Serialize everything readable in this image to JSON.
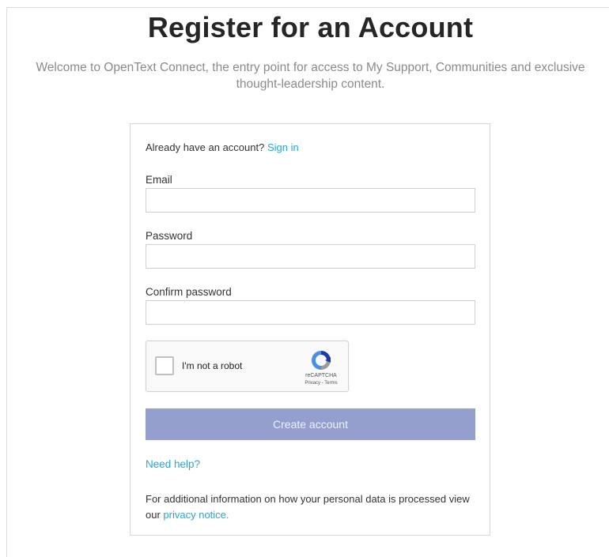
{
  "page": {
    "title": "Register for an Account",
    "intro_line1": "Welcome to OpenText Connect, the entry point for access to My Support, Communities and exclusive",
    "intro_line2": "thought-leadership content."
  },
  "form": {
    "signin_prompt": "Already have an account?",
    "signin_link": "Sign in",
    "email_label": "Email",
    "email_value": "",
    "password_label": "Password",
    "password_value": "",
    "confirm_label": "Confirm password",
    "confirm_value": "",
    "recaptcha": {
      "label": "I'm not a robot",
      "brand": "reCAPTCHA",
      "privacy": "Privacy",
      "separator": " - ",
      "terms": "Terms",
      "icon": "recaptcha-logo-icon"
    },
    "create_button": "Create account",
    "need_help_link": "Need help?",
    "privacy_text_prefix": "For additional information on how your personal data is processed view our",
    "privacy_link": "privacy notice."
  },
  "colors": {
    "link": "#27a6d9",
    "button_bg": "#959fce",
    "intro_text": "#8a8a8a"
  }
}
